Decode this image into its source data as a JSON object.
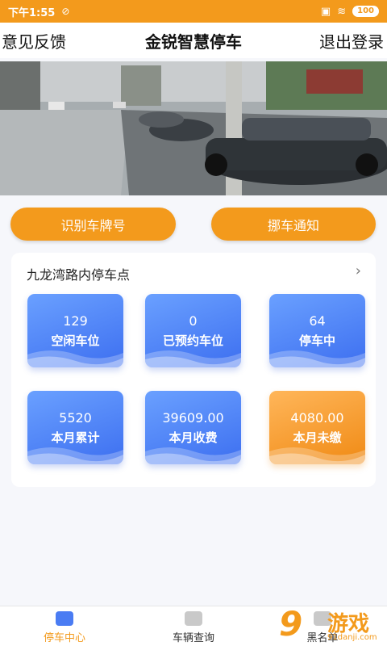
{
  "status_bar": {
    "time": "下午1:55",
    "battery": "100"
  },
  "header": {
    "left": "意见反馈",
    "title": "金锐智慧停车",
    "right": "退出登录"
  },
  "actions": {
    "recognize": "识别车牌号",
    "move_notice": "挪车通知"
  },
  "lot": {
    "name": "九龙湾路内停车点",
    "stats": [
      {
        "value": "129",
        "label": "空闲车位"
      },
      {
        "value": "0",
        "label": "已预约车位"
      },
      {
        "value": "64",
        "label": "停车中"
      },
      {
        "value": "5520",
        "label": "本月累计"
      },
      {
        "value": "39609.00",
        "label": "本月收费"
      },
      {
        "value": "4080.00",
        "label": "本月未缴"
      }
    ]
  },
  "tabs": {
    "parking_center": "停车中心",
    "vehicle_query": "车辆查询",
    "blacklist": "黑名单"
  },
  "watermark": {
    "number": "9",
    "text": "游戏",
    "site": "91danji.com"
  },
  "colors": {
    "accent": "#f39a1c",
    "tile_blue": "#4a7cf3",
    "tile_orange": "#f29322"
  }
}
